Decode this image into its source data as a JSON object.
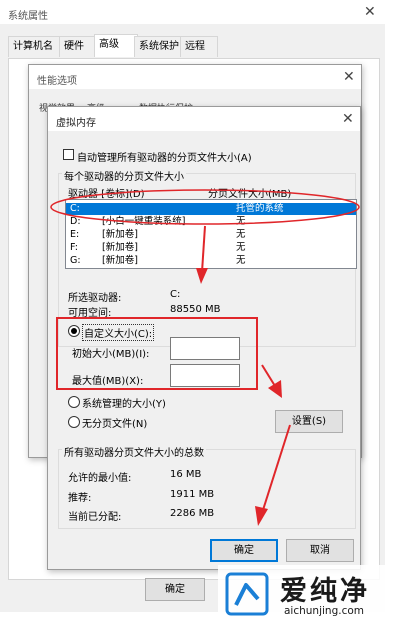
{
  "sysprops": {
    "title": "系统属性",
    "tabs": [
      "计算机名",
      "硬件",
      "高级",
      "系统保护",
      "远程"
    ],
    "selected_tab": "高级",
    "ok_label": "确定"
  },
  "perf": {
    "title": "性能选项",
    "tabs": [
      "视觉效果",
      "高级",
      "数据执行保护"
    ]
  },
  "vm": {
    "title": "虚拟内存",
    "auto_manage_label": "自动管理所有驱动器的分页文件大小(A)",
    "auto_manage_checked": false,
    "per_drive_legend": "每个驱动器的分页文件大小",
    "col_drive": "驱动器 [卷标](D)",
    "col_size": "分页文件大小(MB)",
    "drives": [
      {
        "drive": "C:",
        "label": "",
        "size": "托管的系统",
        "selected": true
      },
      {
        "drive": "D:",
        "label": "[小白一键重装系统]",
        "size": "无",
        "selected": false
      },
      {
        "drive": "E:",
        "label": "[新加卷]",
        "size": "无",
        "selected": false
      },
      {
        "drive": "F:",
        "label": "[新加卷]",
        "size": "无",
        "selected": false
      },
      {
        "drive": "G:",
        "label": "[新加卷]",
        "size": "无",
        "selected": false
      }
    ],
    "selected_drive_label": "所选驱动器:",
    "selected_drive_value": "C:",
    "free_space_label": "可用空间:",
    "free_space_value": "88550 MB",
    "custom_size_label": "自定义大小(C):",
    "initial_size_label": "初始大小(MB)(I):",
    "initial_size_value": "",
    "max_size_label": "最大值(MB)(X):",
    "max_size_value": "",
    "system_managed_label": "系统管理的大小(Y)",
    "no_paging_label": "无分页文件(N)",
    "selected_option": "custom",
    "set_button": "设置(S)",
    "total_legend": "所有驱动器分页文件大小的总数",
    "min_allowed_label": "允许的最小值:",
    "min_allowed_value": "16 MB",
    "recommended_label": "推荐:",
    "recommended_value": "1911 MB",
    "allocated_label": "当前已分配:",
    "allocated_value": "2286 MB",
    "ok_button": "确定",
    "cancel_button": "取消"
  },
  "watermark": {
    "brand": "爱纯净",
    "url": "aichunjing.com"
  },
  "colors": {
    "selection": "#0078d7",
    "annotation_red": "#e0262a",
    "brand_blue": "#1a7fd6"
  }
}
